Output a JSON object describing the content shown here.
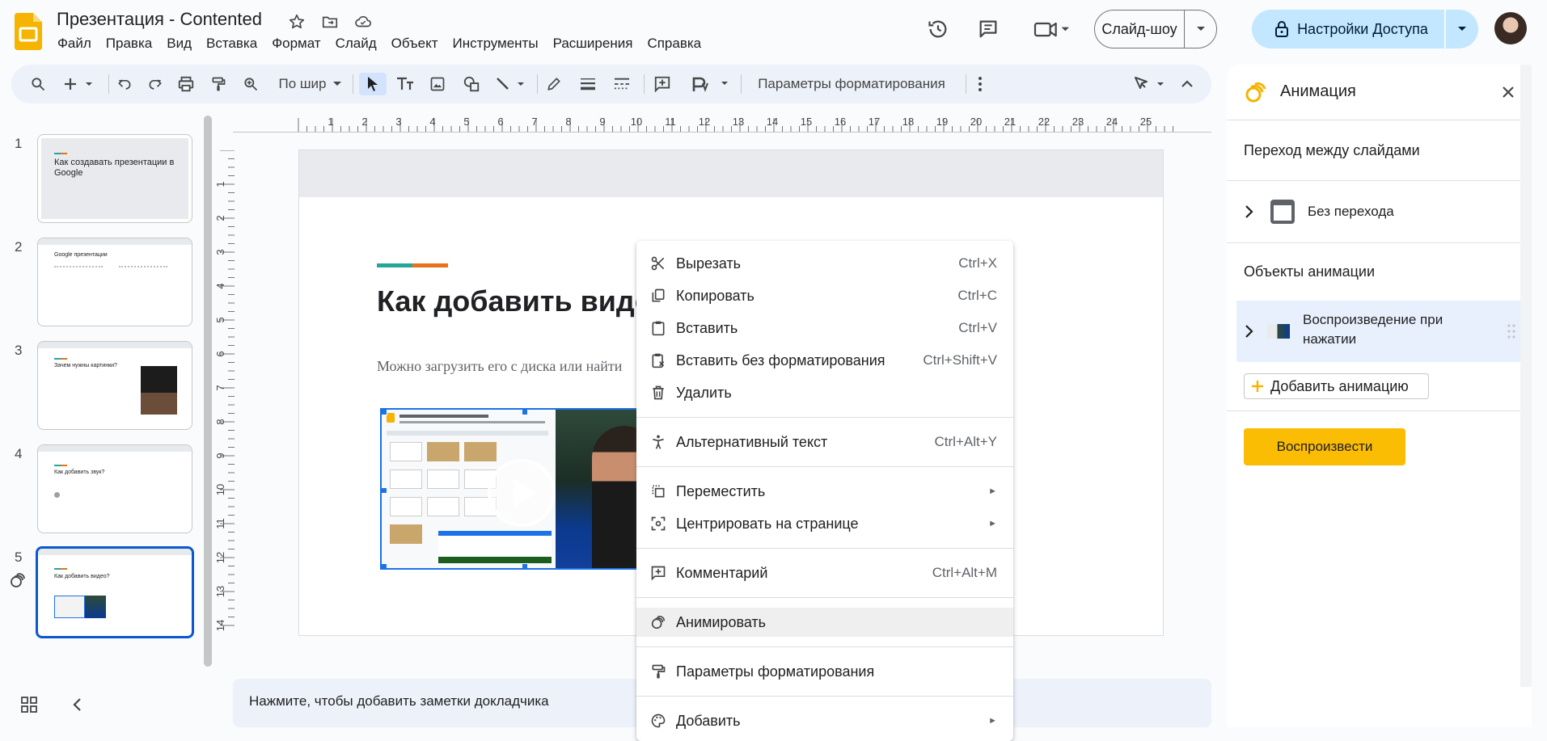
{
  "header": {
    "doc_title": "Презентация - Contented",
    "menu": [
      "Файл",
      "Правка",
      "Вид",
      "Вставка",
      "Формат",
      "Слайд",
      "Объект",
      "Инструменты",
      "Расширения",
      "Справка"
    ],
    "slideshow_label": "Слайд-шоу",
    "share_label": "Настройки Доступа",
    "icons": [
      "star-icon",
      "move-folder-icon",
      "cloud-saved-icon",
      "history-icon",
      "comments-icon",
      "video-call-icon"
    ]
  },
  "toolbar": {
    "zoom_label": "По шир",
    "format_options_label": "Параметры форматирования"
  },
  "filmstrip": {
    "slides": [
      {
        "num": "1",
        "title": "Как создавать презентации в Google"
      },
      {
        "num": "2",
        "title": "Google презентации"
      },
      {
        "num": "3",
        "title": "Зачем нужны картинки?"
      },
      {
        "num": "4",
        "title": "Как добавить звук?"
      },
      {
        "num": "5",
        "title": "Как добавить видео?"
      }
    ]
  },
  "ruler": {
    "horizontal": [
      "1",
      "2",
      "3",
      "4",
      "5",
      "6",
      "7",
      "8",
      "9",
      "10",
      "11",
      "12",
      "13",
      "14",
      "15",
      "16",
      "17",
      "18",
      "19",
      "20",
      "21",
      "22",
      "23",
      "24",
      "25"
    ],
    "vertical": [
      "1",
      "2",
      "3",
      "4",
      "5",
      "6",
      "7",
      "8",
      "9",
      "10",
      "11",
      "12",
      "13",
      "14"
    ]
  },
  "slide": {
    "title": "Как добавить виде",
    "body": "Можно загрузить его с диска или найти"
  },
  "context_menu": {
    "items": [
      {
        "label": "Вырезать",
        "shortcut": "Ctrl+X"
      },
      {
        "label": "Копировать",
        "shortcut": "Ctrl+C"
      },
      {
        "label": "Вставить",
        "shortcut": "Ctrl+V"
      },
      {
        "label": "Вставить без форматирования",
        "shortcut": "Ctrl+Shift+V"
      },
      {
        "label": "Удалить",
        "shortcut": ""
      },
      {
        "label": "Альтернативный текст",
        "shortcut": "Ctrl+Alt+Y"
      },
      {
        "label": "Переместить",
        "shortcut": ""
      },
      {
        "label": "Центрировать на странице",
        "shortcut": ""
      },
      {
        "label": "Комментарий",
        "shortcut": "Ctrl+Alt+M"
      },
      {
        "label": "Анимировать",
        "shortcut": ""
      },
      {
        "label": "Параметры форматирования",
        "shortcut": ""
      },
      {
        "label": "Добавить",
        "shortcut": ""
      }
    ]
  },
  "notes": {
    "placeholder": "Нажмите, чтобы добавить заметки докладчика"
  },
  "animation_panel": {
    "title": "Анимация",
    "transition_section": "Переход между слайдами",
    "transition_value": "Без перехода",
    "objects_section": "Объекты анимации",
    "object_item": "Воспроизведение при нажатии",
    "add_animation": "Добавить анимацию",
    "play": "Воспроизвести"
  },
  "colors": {
    "accent_blue": "#0b57d0",
    "share_bg": "#c2e7ff",
    "play_button": "#fbbc04",
    "slides_logo": "#f4b400"
  }
}
